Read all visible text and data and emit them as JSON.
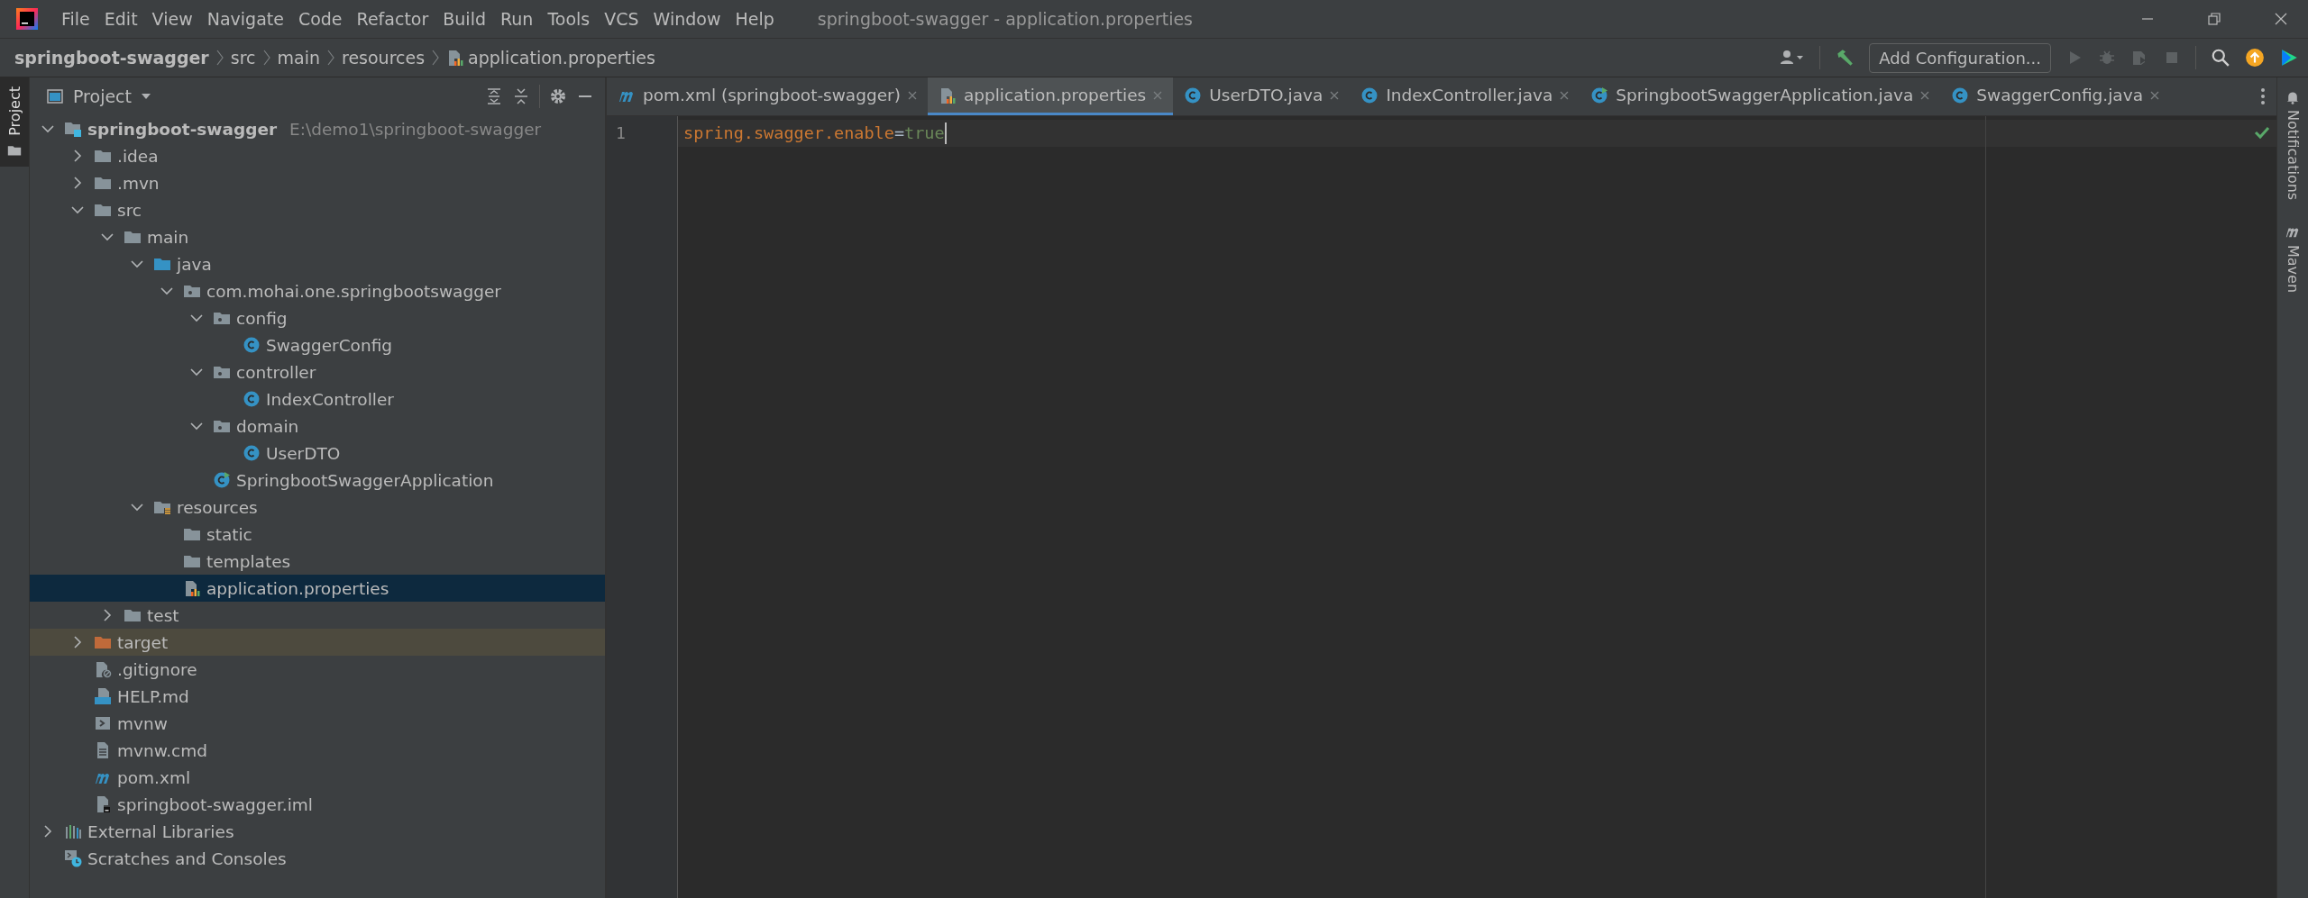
{
  "window": {
    "title": "springboot-swagger - application.properties"
  },
  "menu": [
    "File",
    "Edit",
    "View",
    "Navigate",
    "Code",
    "Refactor",
    "Build",
    "Run",
    "Tools",
    "VCS",
    "Window",
    "Help"
  ],
  "breadcrumbs": [
    {
      "label": "springboot-swagger",
      "kind": "project"
    },
    {
      "label": "src",
      "kind": "folder"
    },
    {
      "label": "main",
      "kind": "folder"
    },
    {
      "label": "resources",
      "kind": "folder"
    },
    {
      "label": "application.properties",
      "kind": "properties"
    }
  ],
  "toolbar": {
    "run_configuration": "Add Configuration..."
  },
  "left_tool_windows": [
    {
      "label": "Project",
      "selected": true
    }
  ],
  "right_tool_windows": [
    {
      "label": "Notifications",
      "kind": "bell"
    },
    {
      "label": "Maven",
      "kind": "maven"
    }
  ],
  "project_panel": {
    "title": "Project",
    "tree": [
      {
        "label": "springboot-swagger",
        "hint": "E:\\demo1\\springboot-swagger",
        "kind": "module",
        "expanded": true,
        "selected": false,
        "children": [
          {
            "label": ".idea",
            "kind": "folder",
            "expanded": false,
            "selected": false
          },
          {
            "label": ".mvn",
            "kind": "folder",
            "expanded": false,
            "selected": false
          },
          {
            "label": "src",
            "kind": "folder",
            "expanded": true,
            "selected": false,
            "children": [
              {
                "label": "main",
                "kind": "folder",
                "expanded": true,
                "selected": false,
                "children": [
                  {
                    "label": "java",
                    "kind": "source",
                    "expanded": true,
                    "selected": false,
                    "children": [
                      {
                        "label": "com.mohai.one.springbootswagger",
                        "kind": "package",
                        "expanded": true,
                        "selected": false,
                        "children": [
                          {
                            "label": "config",
                            "kind": "package",
                            "expanded": true,
                            "selected": false,
                            "children": [
                              {
                                "label": "SwaggerConfig",
                                "kind": "class",
                                "selected": false
                              }
                            ]
                          },
                          {
                            "label": "controller",
                            "kind": "package",
                            "expanded": true,
                            "selected": false,
                            "children": [
                              {
                                "label": "IndexController",
                                "kind": "class",
                                "selected": false
                              }
                            ]
                          },
                          {
                            "label": "domain",
                            "kind": "package",
                            "expanded": true,
                            "selected": false,
                            "children": [
                              {
                                "label": "UserDTO",
                                "kind": "class",
                                "selected": false
                              }
                            ]
                          },
                          {
                            "label": "SpringbootSwaggerApplication",
                            "kind": "app",
                            "selected": false
                          }
                        ]
                      }
                    ]
                  },
                  {
                    "label": "resources",
                    "kind": "resources",
                    "expanded": true,
                    "selected": false,
                    "children": [
                      {
                        "label": "static",
                        "kind": "folder",
                        "selected": false
                      },
                      {
                        "label": "templates",
                        "kind": "folder",
                        "selected": false
                      },
                      {
                        "label": "application.properties",
                        "kind": "properties",
                        "selected": true
                      }
                    ]
                  }
                ]
              },
              {
                "label": "test",
                "kind": "folder",
                "expanded": false,
                "selected": false
              }
            ]
          },
          {
            "label": "target",
            "kind": "excluded",
            "expanded": false,
            "selected": false
          },
          {
            "label": ".gitignore",
            "kind": "gitignore",
            "selected": false
          },
          {
            "label": "HELP.md",
            "kind": "markdown",
            "selected": false
          },
          {
            "label": "mvnw",
            "kind": "shell",
            "selected": false
          },
          {
            "label": "mvnw.cmd",
            "kind": "text",
            "selected": false
          },
          {
            "label": "pom.xml",
            "kind": "maven",
            "selected": false
          },
          {
            "label": "springboot-swagger.iml",
            "kind": "iml",
            "selected": false
          }
        ]
      },
      {
        "label": "External Libraries",
        "kind": "libraries",
        "expanded": false,
        "selected": false
      },
      {
        "label": "Scratches and Consoles",
        "kind": "scratches",
        "selected": false
      }
    ]
  },
  "editor_tabs": [
    {
      "label": "pom.xml (springboot-swagger)",
      "kind": "maven",
      "selected": false
    },
    {
      "label": "application.properties",
      "kind": "properties",
      "selected": true
    },
    {
      "label": "UserDTO.java",
      "kind": "class",
      "selected": false
    },
    {
      "label": "IndexController.java",
      "kind": "class",
      "selected": false
    },
    {
      "label": "SpringbootSwaggerApplication.java",
      "kind": "app",
      "selected": false
    },
    {
      "label": "SwaggerConfig.java",
      "kind": "class",
      "selected": false
    }
  ],
  "editor": {
    "lines": [
      {
        "number": "1",
        "key": "spring.swagger.enable",
        "separator": "=",
        "value": "true"
      }
    ]
  }
}
